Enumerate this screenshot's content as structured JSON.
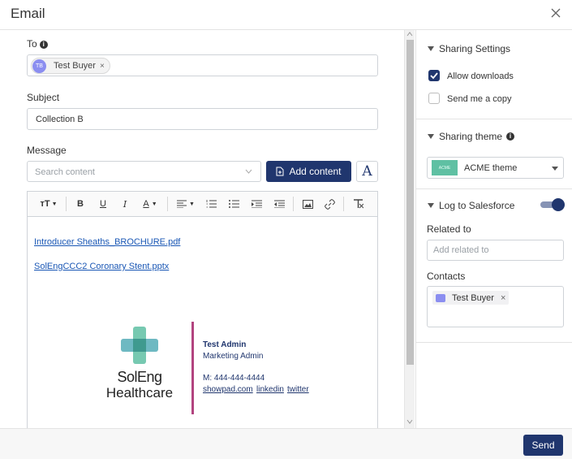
{
  "dialog": {
    "title": "Email"
  },
  "to": {
    "label": "To",
    "recipient": {
      "initials": "TB",
      "name": "Test Buyer",
      "remove": "×"
    }
  },
  "subject": {
    "label": "Subject",
    "value": "Collection B"
  },
  "message": {
    "label": "Message",
    "search_placeholder": "Search content",
    "add_content_label": "Add content",
    "font_button": "A"
  },
  "toolbar": {
    "items": [
      "text-size",
      "bold",
      "underline",
      "italic",
      "font-color",
      "align",
      "ordered-list",
      "bullet-list",
      "indent",
      "outdent",
      "image",
      "link",
      "clear-format"
    ],
    "labels": {
      "bold": "B",
      "underline": "U",
      "italic": "I",
      "font_color": "A",
      "text_size": "тT"
    }
  },
  "body": {
    "attachments": [
      "Introducer Sheaths_BROCHURE.pdf",
      "SolEngCCC2 Coronary Stent.pptx"
    ],
    "signature": {
      "logo_line1": "SolEng",
      "logo_line2": "Healthcare",
      "name": "Test Admin",
      "role": "Marketing Admin",
      "phone": "M: 444-444-4444",
      "links": [
        "showpad.com",
        "linkedin",
        "twitter"
      ]
    }
  },
  "sidebar": {
    "sharing_settings": {
      "title": "Sharing Settings",
      "allow_downloads": {
        "label": "Allow downloads",
        "checked": true
      },
      "send_copy": {
        "label": "Send me a copy",
        "checked": false
      }
    },
    "sharing_theme": {
      "title": "Sharing theme",
      "selected": "ACME theme",
      "thumb_label": "ACME"
    },
    "salesforce": {
      "title": "Log to Salesforce",
      "enabled": true,
      "related_label": "Related to",
      "related_placeholder": "Add related to",
      "contacts_label": "Contacts",
      "contact": {
        "name": "Test Buyer",
        "remove": "×"
      }
    }
  },
  "footer": {
    "send_label": "Send"
  },
  "colors": {
    "primary": "#20366e",
    "link": "#1a57b5",
    "signature_accent": "#b2447f",
    "logo_teal": "#5fc0a3"
  }
}
